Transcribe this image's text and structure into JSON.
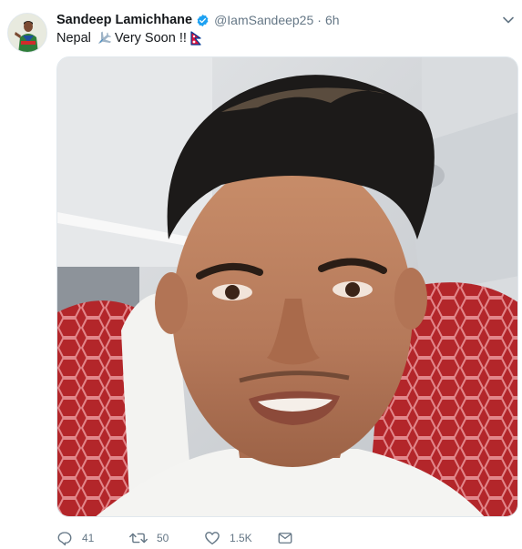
{
  "tweet": {
    "author_name": "Sandeep Lamichhane",
    "handle": "@IamSandeep25",
    "separator": "·",
    "time": "6h",
    "text_before": "Nepal",
    "text_after": "Very Soon !!",
    "airplane_emoji": "airplane-emoji",
    "flag_emoji": "nepal-flag-emoji"
  },
  "actions": {
    "reply_count": "41",
    "retweet_count": "50",
    "like_count": "1.5K"
  },
  "colors": {
    "text": "#14171a",
    "muted": "#657786",
    "verified": "#1da1f2",
    "border": "#e1e8ed"
  }
}
